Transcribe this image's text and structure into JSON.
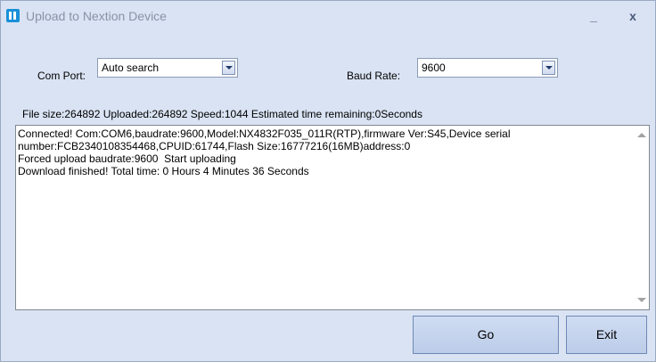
{
  "window": {
    "title": "Upload to Nextion Device",
    "minimize_label": "_",
    "close_label": "x"
  },
  "com_port": {
    "label": "Com Port:",
    "value": "Auto search"
  },
  "baud_rate": {
    "label": "Baud Rate:",
    "value": "9600"
  },
  "status": {
    "file_info": "File size:264892 Uploaded:264892 Speed:1044 Estimated time remaining:0Seconds"
  },
  "log": {
    "text": "Connected! Com:COM6,baudrate:9600,Model:NX4832F035_011R(RTP),firmware Ver:S45,Device serial number:FCB2340108354468,CPUID:61744,Flash Size:16777216(16MB)address:0\nForced upload baudrate:9600  Start uploading\nDownload finished! Total time: 0 Hours 4 Minutes 36 Seconds"
  },
  "buttons": {
    "go": "Go",
    "exit": "Exit"
  },
  "icons": {
    "app": "nextion-logo-icon",
    "dropdown": "chevron-down-icon",
    "scroll_up": "scroll-up-arrow-icon",
    "scroll_down": "scroll-down-arrow-icon"
  },
  "colors": {
    "window_bg": "#d9e3f3",
    "title_text": "#8a93a6",
    "button_bg": "#c6d5ee",
    "brand_icon": "#1a8fd8"
  }
}
